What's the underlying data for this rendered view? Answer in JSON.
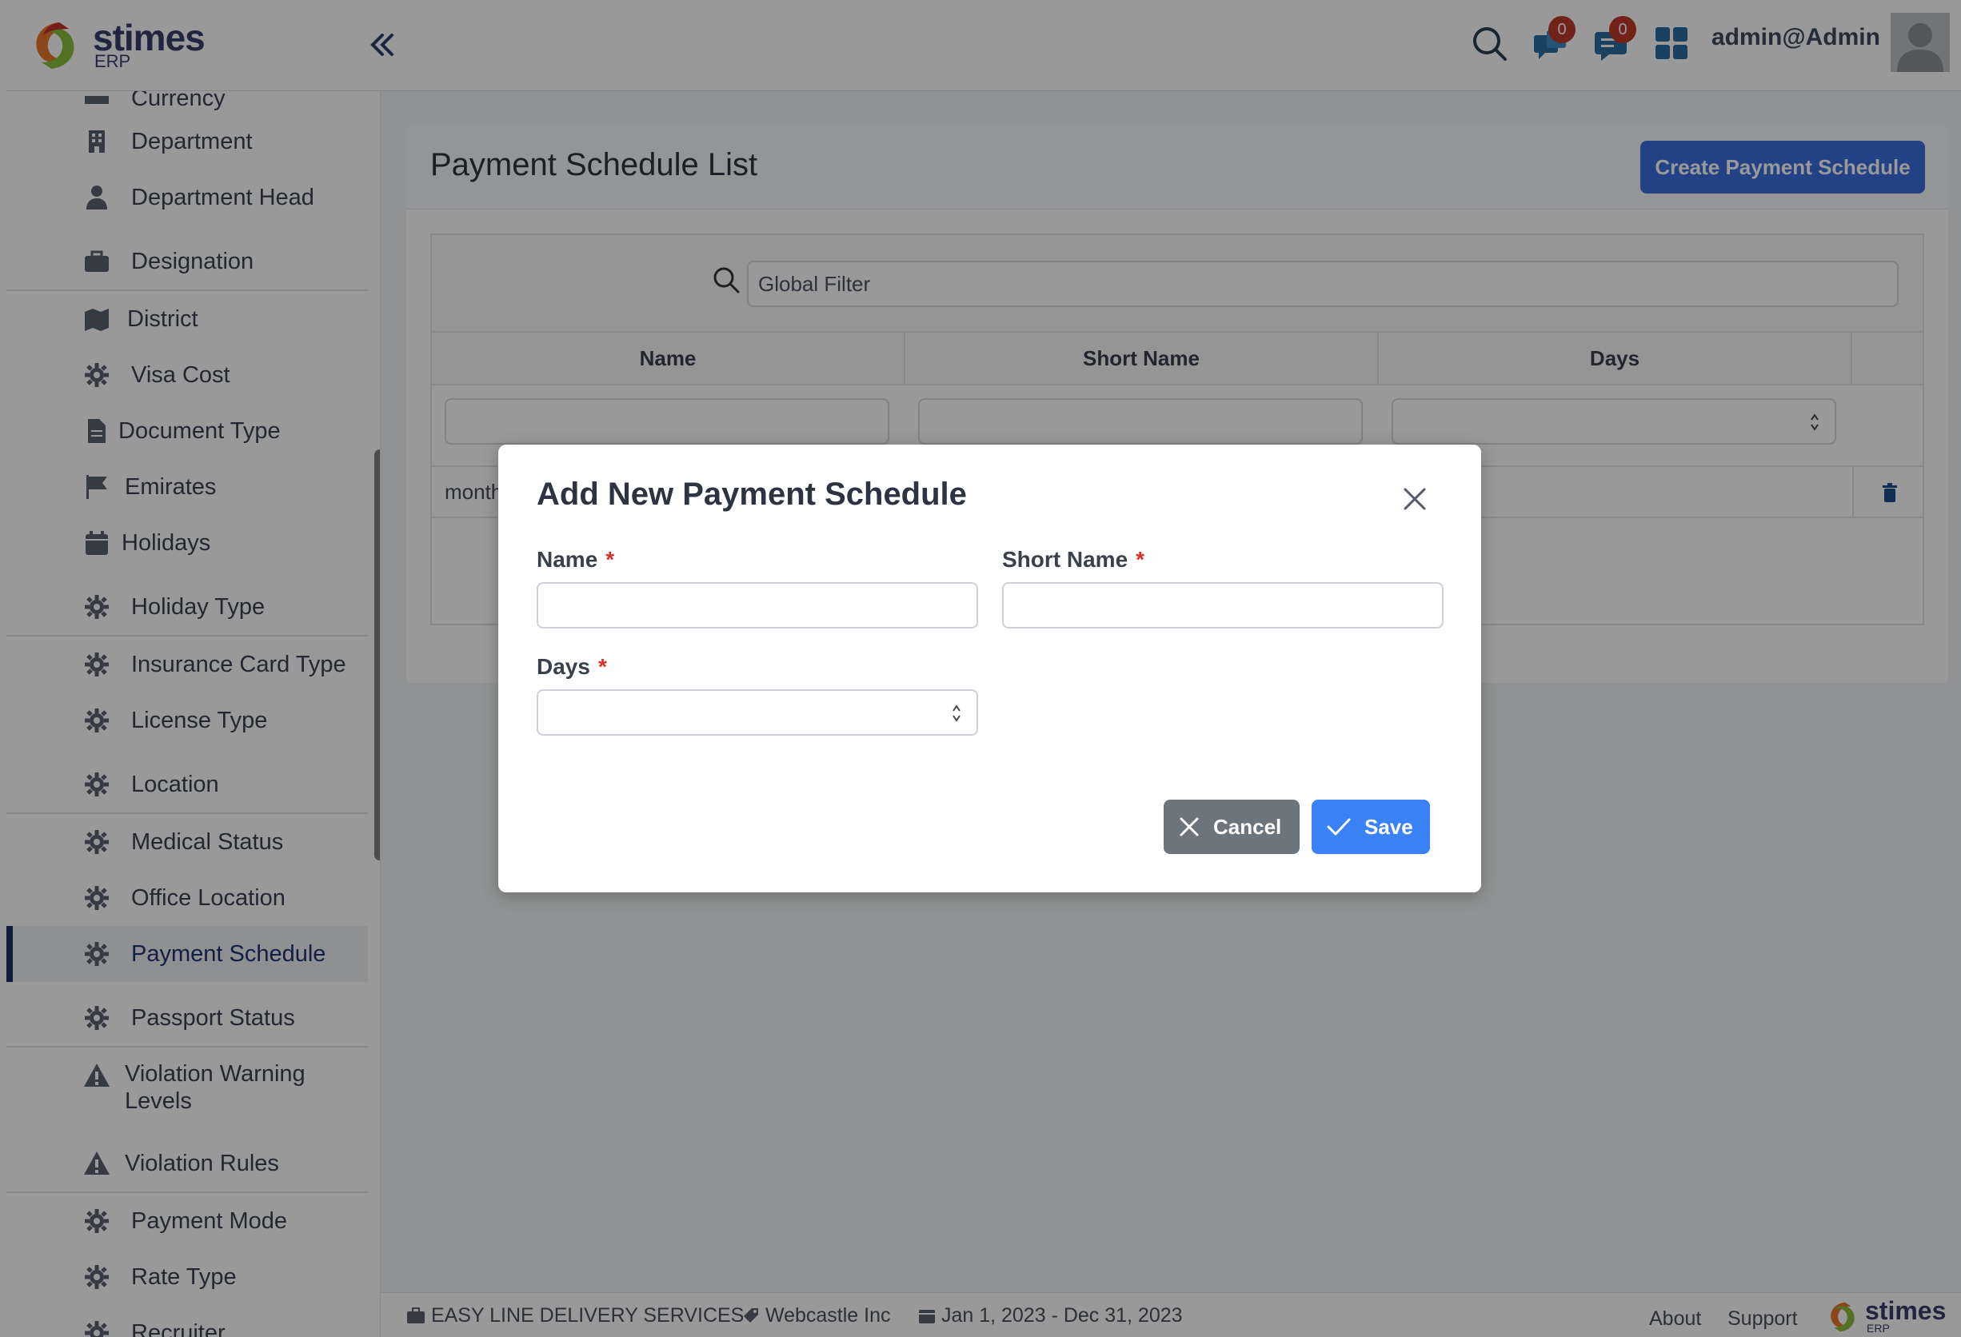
{
  "app": {
    "logo_text": "stimes",
    "logo_sub": "ERP"
  },
  "header": {
    "user_name": "admin@Admin",
    "notifications_count": "0",
    "messages_count": "0"
  },
  "sidebar": {
    "items": [
      {
        "label": "Currency"
      },
      {
        "label": "Department"
      },
      {
        "label": "Department Head"
      },
      {
        "label": "Designation"
      },
      {
        "label": "District"
      },
      {
        "label": "Visa Cost"
      },
      {
        "label": "Document Type"
      },
      {
        "label": "Emirates"
      },
      {
        "label": "Holidays"
      },
      {
        "label": "Holiday Type"
      },
      {
        "label": "Insurance Card Type"
      },
      {
        "label": "License Type"
      },
      {
        "label": "Location"
      },
      {
        "label": "Medical Status"
      },
      {
        "label": "Office Location"
      },
      {
        "label": "Payment Schedule"
      },
      {
        "label": "Passport Status"
      },
      {
        "label": "Violation Warning"
      },
      {
        "label": "Levels"
      },
      {
        "label": "Violation Rules"
      },
      {
        "label": "Payment Mode"
      },
      {
        "label": "Rate Type"
      },
      {
        "label": "Recruiter"
      }
    ]
  },
  "main": {
    "title": "Payment Schedule List",
    "create_button": "Create Payment Schedule",
    "global_filter_placeholder": "Global Filter",
    "columns": [
      "Name",
      "Short Name",
      "Days"
    ],
    "rows": [
      {
        "name": "month"
      }
    ]
  },
  "modal": {
    "title": "Add New Payment Schedule",
    "name_label": "Name",
    "short_name_label": "Short Name",
    "days_label": "Days",
    "required_mark": "*",
    "cancel_label": "Cancel",
    "save_label": "Save"
  },
  "footer": {
    "company": "EASY LINE DELIVERY SERVICES",
    "branch": "Webcastle Inc",
    "period": "Jan 1, 2023 - Dec 31, 2023",
    "about": "About",
    "support": "Support",
    "logo_text": "stimes",
    "logo_sub": "ERP"
  },
  "colors": {
    "primary": "#3b6fe0",
    "save": "#3b82f6",
    "cancel": "#6c757d",
    "active_nav": "#1f2f66",
    "badge": "#c0392b"
  }
}
